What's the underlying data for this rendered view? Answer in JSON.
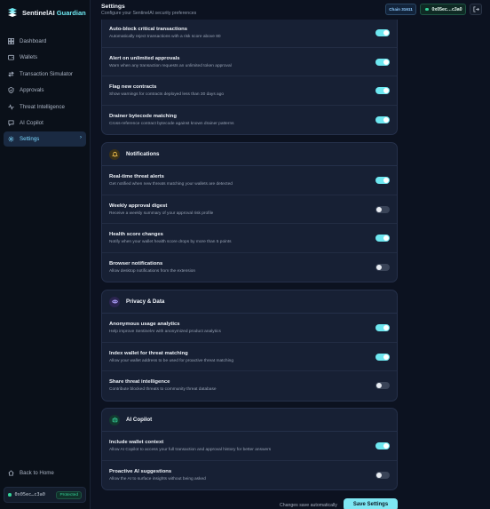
{
  "brand": {
    "name": "SentinelAI",
    "suffix": "Guardian"
  },
  "sidebar": {
    "items": [
      {
        "label": "Dashboard",
        "icon": "grid-icon"
      },
      {
        "label": "Wallets",
        "icon": "wallet-icon"
      },
      {
        "label": "Transaction Simulator",
        "icon": "arrows-icon"
      },
      {
        "label": "Approvals",
        "icon": "shield-check-icon"
      },
      {
        "label": "Threat Intelligence",
        "icon": "pulse-icon"
      },
      {
        "label": "AI Copilot",
        "icon": "chat-icon"
      },
      {
        "label": "Settings",
        "icon": "gear-icon",
        "active": true
      }
    ],
    "back_home": "Back to Home",
    "wallet": {
      "address": "0x05ec…c3a0",
      "status": "Protected"
    }
  },
  "header": {
    "title": "Settings",
    "subtitle": "Configure your SentinelAI security preferences",
    "chain": "Chain 31611",
    "address": "0x05ec…c3a0"
  },
  "colors": {
    "accent": "#6ee7f0",
    "success": "#34d399",
    "background": "#0c1220",
    "card": "#172034"
  },
  "security": {
    "rows": [
      {
        "title": "Auto-block critical transactions",
        "desc": "Automatically reject transactions with a risk score above 80",
        "on": true
      },
      {
        "title": "Alert on unlimited approvals",
        "desc": "Warn when any transaction requests an unlimited token approval",
        "on": true
      },
      {
        "title": "Flag new contracts",
        "desc": "Show warnings for contracts deployed less than 30 days ago",
        "on": true
      },
      {
        "title": "Drainer bytecode matching",
        "desc": "Cross-reference contract bytecode against known drainer patterns",
        "on": true
      }
    ]
  },
  "notifications": {
    "title": "Notifications",
    "rows": [
      {
        "title": "Real-time threat alerts",
        "desc": "Get notified when new threats matching your wallets are detected",
        "on": true
      },
      {
        "title": "Weekly approval digest",
        "desc": "Receive a weekly summary of your approval risk profile",
        "on": false
      },
      {
        "title": "Health score changes",
        "desc": "Notify when your wallet health score drops by more than 5 points",
        "on": true
      },
      {
        "title": "Browser notifications",
        "desc": "Allow desktop notifications from the extension",
        "on": false
      }
    ]
  },
  "privacy": {
    "title": "Privacy & Data",
    "rows": [
      {
        "title": "Anonymous usage analytics",
        "desc": "Help improve SentinelAI with anonymized product analytics",
        "on": true
      },
      {
        "title": "Index wallet for threat matching",
        "desc": "Allow your wallet address to be used for proactive threat matching",
        "on": true
      },
      {
        "title": "Share threat intelligence",
        "desc": "Contribute blocked threats to community threat database",
        "on": false
      }
    ]
  },
  "ai_copilot": {
    "title": "AI Copilot",
    "rows": [
      {
        "title": "Include wallet context",
        "desc": "Allow AI Copilot to access your full transaction and approval history for better answers",
        "on": true
      },
      {
        "title": "Proactive AI suggestions",
        "desc": "Allow the AI to surface insights without being asked",
        "on": false
      }
    ]
  },
  "footer": {
    "note": "Changes save automatically",
    "save_label": "Save Settings"
  }
}
